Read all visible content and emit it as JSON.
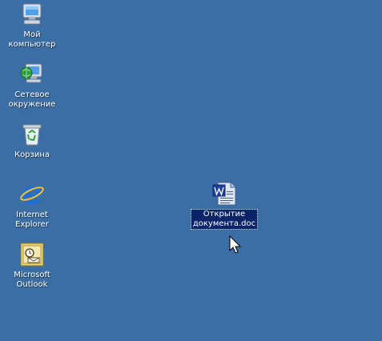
{
  "desktop": {
    "background_color": "#3a6ea5",
    "icons": [
      {
        "label": "Мой\nкомпьютер",
        "icon": "my-computer-icon"
      },
      {
        "label": "Сетевое\nокружение",
        "icon": "network-places-icon"
      },
      {
        "label": "Корзина",
        "icon": "recycle-bin-icon"
      },
      {
        "label": "Internet\nExplorer",
        "icon": "internet-explorer-icon"
      },
      {
        "label": "Microsoft\nOutlook",
        "icon": "outlook-icon"
      },
      {
        "label": "Открытие\nдокумента.doc",
        "icon": "word-document-icon",
        "selected": true
      }
    ]
  },
  "cursor": {
    "icon": "arrow-cursor-icon"
  }
}
